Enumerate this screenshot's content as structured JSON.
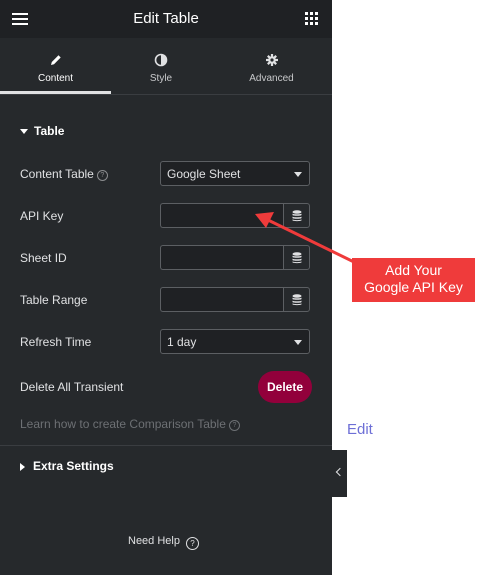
{
  "header": {
    "title": "Edit Table"
  },
  "tabs": [
    {
      "label": "Content",
      "icon": "pencil-icon",
      "active": true
    },
    {
      "label": "Style",
      "icon": "half-circle-icon",
      "active": false
    },
    {
      "label": "Advanced",
      "icon": "gear-icon",
      "active": false
    }
  ],
  "section": {
    "title": "Table"
  },
  "fields": {
    "content_table": {
      "label": "Content Table",
      "value": "Google Sheet"
    },
    "api_key": {
      "label": "API Key",
      "value": ""
    },
    "sheet_id": {
      "label": "Sheet ID",
      "value": ""
    },
    "table_range": {
      "label": "Table Range",
      "value": ""
    },
    "refresh_time": {
      "label": "Refresh Time",
      "value": "1 day"
    }
  },
  "transient": {
    "label": "Delete All Transient",
    "button": "Delete"
  },
  "learn_link": "Learn how to create Comparison Table",
  "extra_settings": "Extra Settings",
  "help": "Need Help",
  "preview": {
    "edit_label": "Edit"
  },
  "callout": {
    "line1": "Add Your",
    "line2": "Google API Key"
  },
  "colors": {
    "panel_bg": "#26292c",
    "delete_bg": "#92003b",
    "callout_bg": "#ef3b3b",
    "edit_link": "#6d6fd6"
  }
}
